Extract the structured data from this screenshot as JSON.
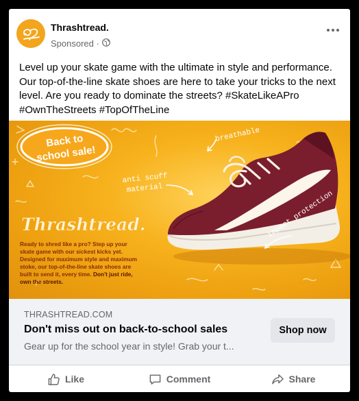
{
  "post": {
    "page_name": "Thrashtread.",
    "sponsored_label": "Sponsored ·",
    "caption": "Level up your skate game with the ultimate in style and performance. Our top-of-the-line skate shoes are here to take your tricks to the next level. Are you ready to dominate the streets? #SkateLikeAPro #OwnTheStreets #TopOfTheLine"
  },
  "creative": {
    "badge_line1": "Back to",
    "badge_line2": "school sale!",
    "label_breathable": "breathable",
    "label_anti_scuff_1": "anti scuff",
    "label_anti_scuff_2": "material",
    "label_impact": "impact protection",
    "brand_script": "Thrashtread.",
    "ad_copy_main": "Ready to shred like a pro? Step up your skate game with our sickest kicks yet. Designed for maximum style and maximum stoke, our top-of-the-line skate shoes are built to send it, every time. ",
    "ad_copy_bold": "Don't just ride, own the streets."
  },
  "link": {
    "domain": "THRASHTREAD.COM",
    "headline": "Don't miss out on back-to-school sales",
    "description": "Gear up for the school year in style! Grab your t...",
    "cta": "Shop now"
  },
  "actions": {
    "like": "Like",
    "comment": "Comment",
    "share": "Share"
  },
  "colors": {
    "brand_orange": "#f2a51d",
    "shoe_maroon": "#7a1e2e"
  }
}
